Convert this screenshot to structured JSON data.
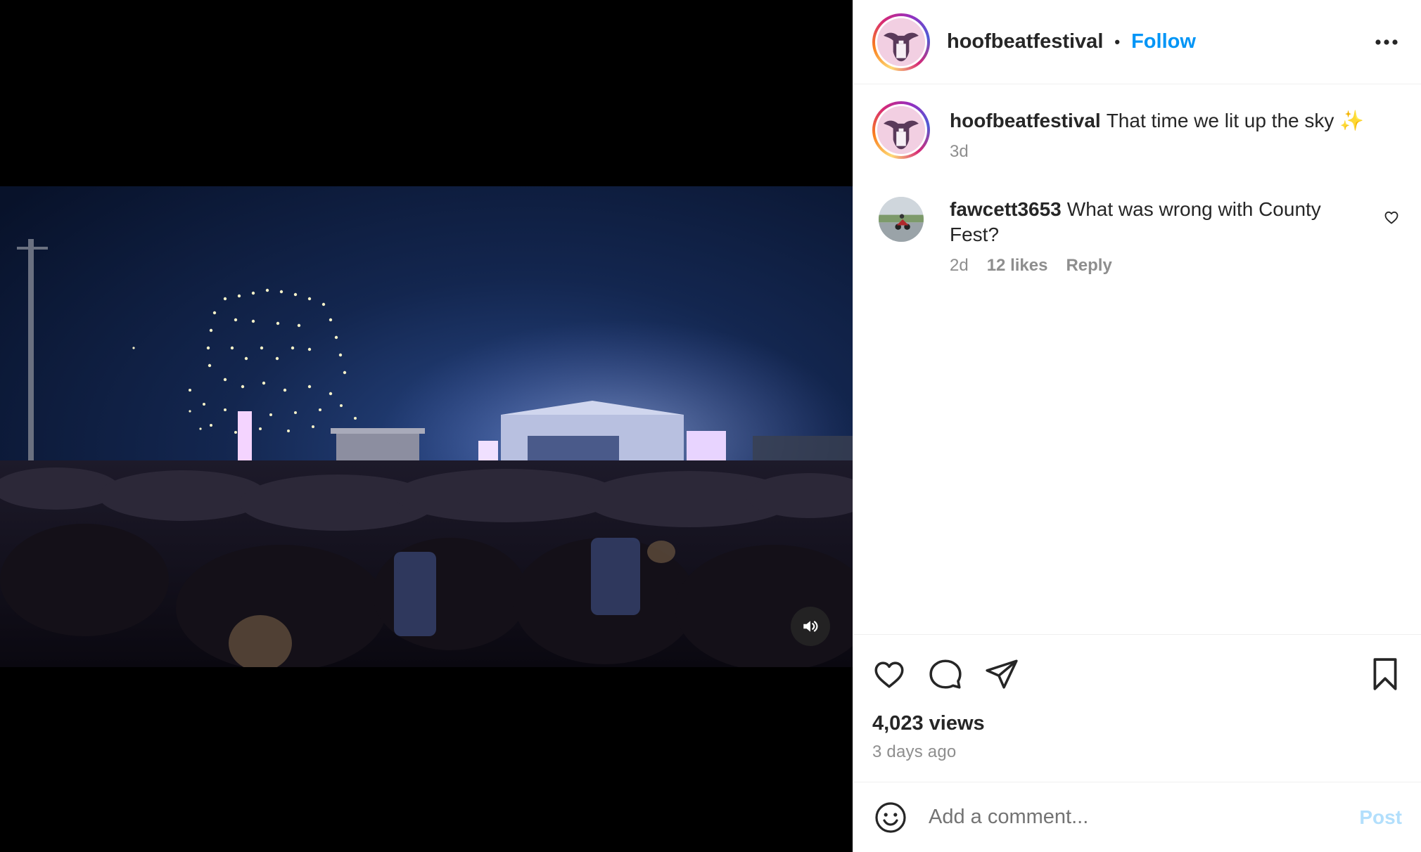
{
  "post": {
    "author": "hoofbeatfestival",
    "separator": "•",
    "follow_label": "Follow",
    "more_icon": "more-horizontal-icon"
  },
  "caption": {
    "user": "hoofbeatfestival",
    "text": "That time we lit up the sky ✨",
    "time": "3d"
  },
  "comments": [
    {
      "user": "fawcett3653",
      "text": "What was wrong with County Fest?",
      "time": "2d",
      "likes": "12 likes",
      "reply_label": "Reply"
    }
  ],
  "stats": {
    "views": "4,023 views",
    "posted": "3 days ago"
  },
  "composer": {
    "placeholder": "Add a comment...",
    "post_label": "Post"
  },
  "colors": {
    "link_blue": "#0095f6",
    "post_disabled": "#b2dffc",
    "secondary_text": "#8e8e8e"
  }
}
